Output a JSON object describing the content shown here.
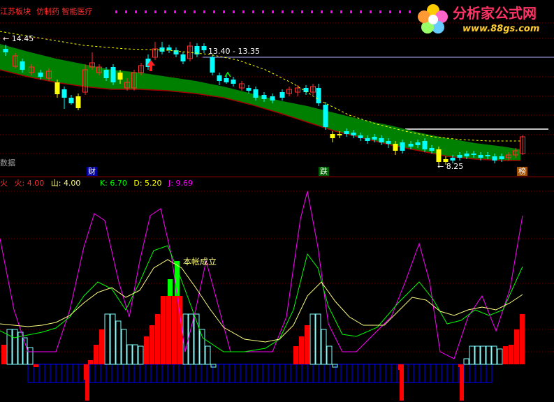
{
  "header": {
    "sector_label": "江苏板块",
    "concepts_label": "仿制药 智能医疗",
    "tag_color": "#ff3030"
  },
  "price_panel": {
    "high_label": "14.45",
    "range_label": "13.40 - 13.35",
    "low_label": "8.25",
    "data_label": "数据",
    "events": [
      "财",
      "跌",
      "榜"
    ],
    "colors": {
      "up_candle": "#ff3030",
      "down_candle": "#00ffff",
      "band_fill": "#008000",
      "band_edge": "#a00000",
      "dashed_ma": "#ffff00",
      "yellow_candle": "#ffff00"
    }
  },
  "indicator_panel": {
    "legend": [
      {
        "name": "火",
        "value": "",
        "color": "#ff3030"
      },
      {
        "name": "火:",
        "value": "4.00",
        "color": "#ff3030"
      },
      {
        "name": "山:",
        "value": "4.00",
        "color": "#ffff80"
      },
      {
        "name": "K:",
        "value": "6.70",
        "color": "#00ff00"
      },
      {
        "name": "D:",
        "value": "5.20",
        "color": "#ffff00"
      },
      {
        "name": "J:",
        "value": "9.69",
        "color": "#ff00ff"
      }
    ],
    "annotation": "本帐成立",
    "colors": {
      "fire_bar": "#ff0000",
      "mountain_bar": "#80ffff",
      "base_bar": "#0000ff",
      "k_line": "#00ff00",
      "d_line": "#ffff80",
      "j_line": "#ff00ff",
      "signal_bar": "#00ff00"
    }
  },
  "logo": {
    "title": "分析家公式网",
    "url": "www.88gs.com"
  }
}
